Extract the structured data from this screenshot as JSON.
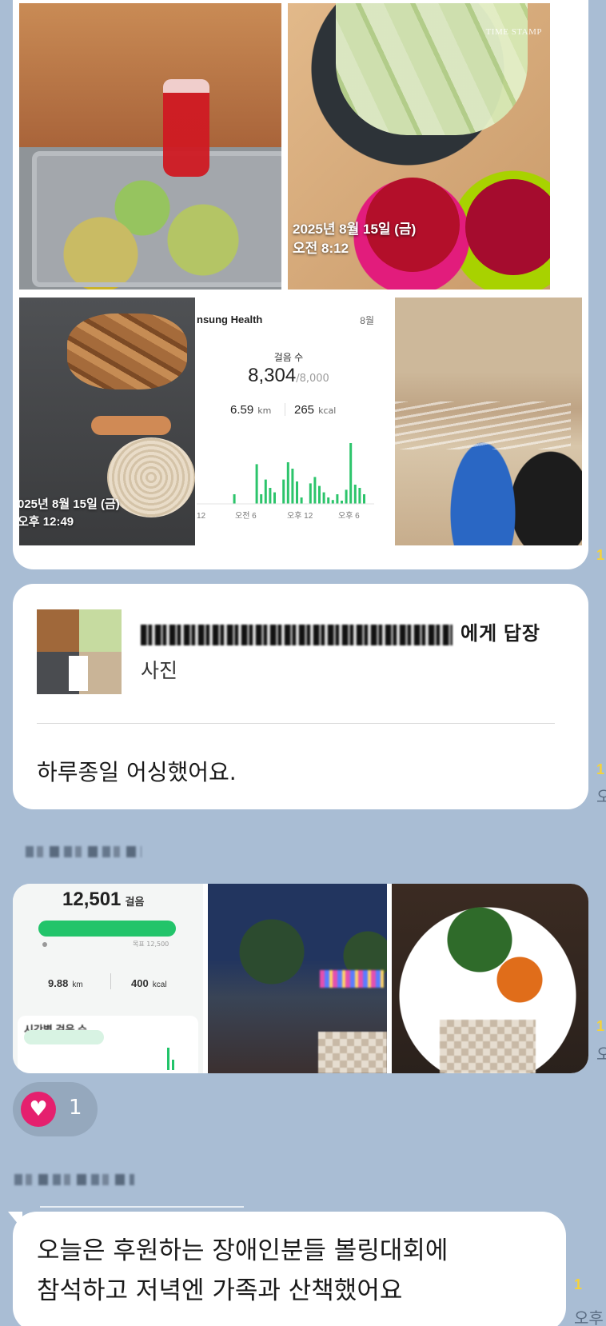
{
  "message1": {
    "photo2_timestamp_date": "2025년 8월 15일 (금)",
    "photo2_timestamp_time": "오전 8:12",
    "photo2_logo": "TIME STAMP",
    "photo3_timestamp_date": "025년 8월 15일 (금)",
    "photo3_timestamp_time": "오후 12:49",
    "health": {
      "app_name": "nsung Health",
      "month": "8월",
      "steps_label": "걸음 수",
      "steps": "8,304",
      "goal": "/8,000",
      "distance": "6.59",
      "distance_unit": "km",
      "calories": "265",
      "calories_unit": "kcal",
      "axis": [
        "12",
        "오전 6",
        "오후 12",
        "오후 6"
      ],
      "hourly_steps_relative": [
        0,
        0,
        0,
        0,
        0,
        0,
        0.15,
        0,
        0,
        0,
        0,
        0.62,
        0.15,
        0.38,
        0.25,
        0.18,
        0,
        0.38,
        0.65,
        0.55,
        0.35,
        0.1,
        0,
        0.32,
        0.42,
        0.28,
        0.18,
        0.1,
        0.06,
        0.15,
        0.05,
        0.22,
        0.95,
        0.3,
        0.25,
        0.15,
        0
      ]
    }
  },
  "reply": {
    "target_suffix": "에게 답장",
    "reply_type": "사진",
    "text": "하루종일 어싱했어요."
  },
  "side_markers": {
    "m1_count": "1",
    "m2_count": "1",
    "m2_time": "오",
    "m3_count": "1",
    "m3_time": "오",
    "m4_count": "1",
    "m4_time": "오후"
  },
  "message2": {
    "steps": "12,501",
    "steps_unit": "걸음",
    "bar_right_label": "목표 12,500",
    "distance": "9.88",
    "distance_unit": "km",
    "calories": "400",
    "calories_unit": "kcal",
    "section_title": "시간별 걸음 수"
  },
  "reaction": {
    "icon": "heart-icon",
    "count": "1"
  },
  "message3": {
    "line1": "오늘은 후원하는  장애인분들 볼링대회에",
    "line2": "참석하고 저녁엔 가족과 산책했어요"
  },
  "colors": {
    "background": "#a9bdd4",
    "bubble": "#ffffff",
    "unread": "#f5d33a",
    "reaction_heart": "#e5206e",
    "step_bar": "#22c46a"
  }
}
